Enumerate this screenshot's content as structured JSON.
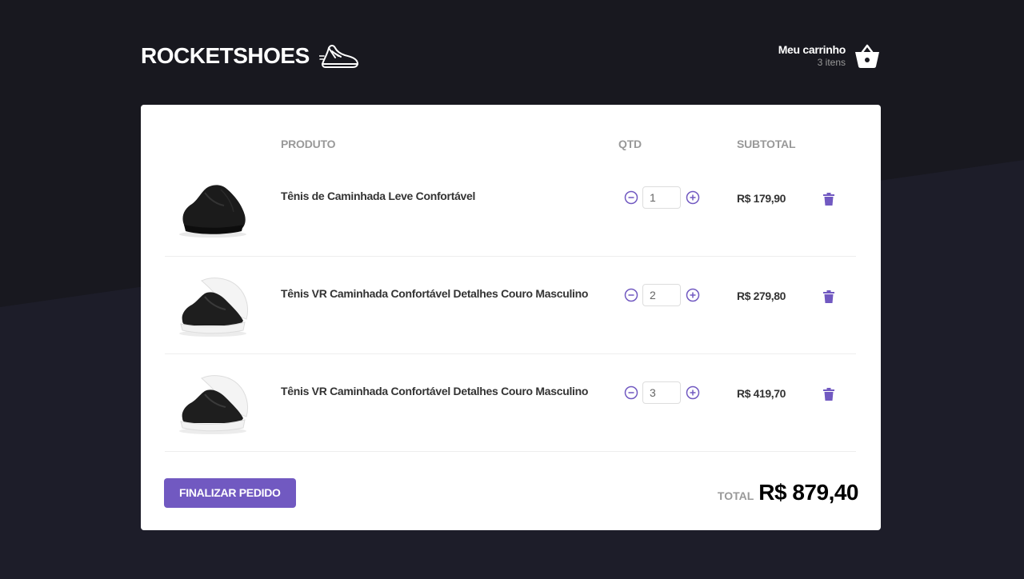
{
  "header": {
    "logo_text": "ROCKETSHOES",
    "cart_title": "Meu carrinho",
    "cart_count": "3 itens"
  },
  "colors": {
    "background": "#191920",
    "accent": "#7159c1",
    "card": "#ffffff"
  },
  "table": {
    "columns": [
      "PRODUTO",
      "QTD",
      "SUBTOTAL"
    ],
    "rows": [
      {
        "title": "Tênis de Caminhada Leve Confortável",
        "quantity": "1",
        "subtotal": "R$ 179,90",
        "image": "black-sneaker-icon"
      },
      {
        "title": "Tênis VR Caminhada Confortável Detalhes Couro Masculino",
        "quantity": "2",
        "subtotal": "R$ 279,80",
        "image": "black-white-sneaker-icon"
      },
      {
        "title": "Tênis VR Caminhada Confortável Detalhes Couro Masculino",
        "quantity": "3",
        "subtotal": "R$ 419,70",
        "image": "black-white-sneaker-icon"
      }
    ]
  },
  "footer": {
    "finalize_label": "FINALIZAR PEDIDO",
    "total_label": "TOTAL",
    "total_value": "R$ 879,40"
  }
}
